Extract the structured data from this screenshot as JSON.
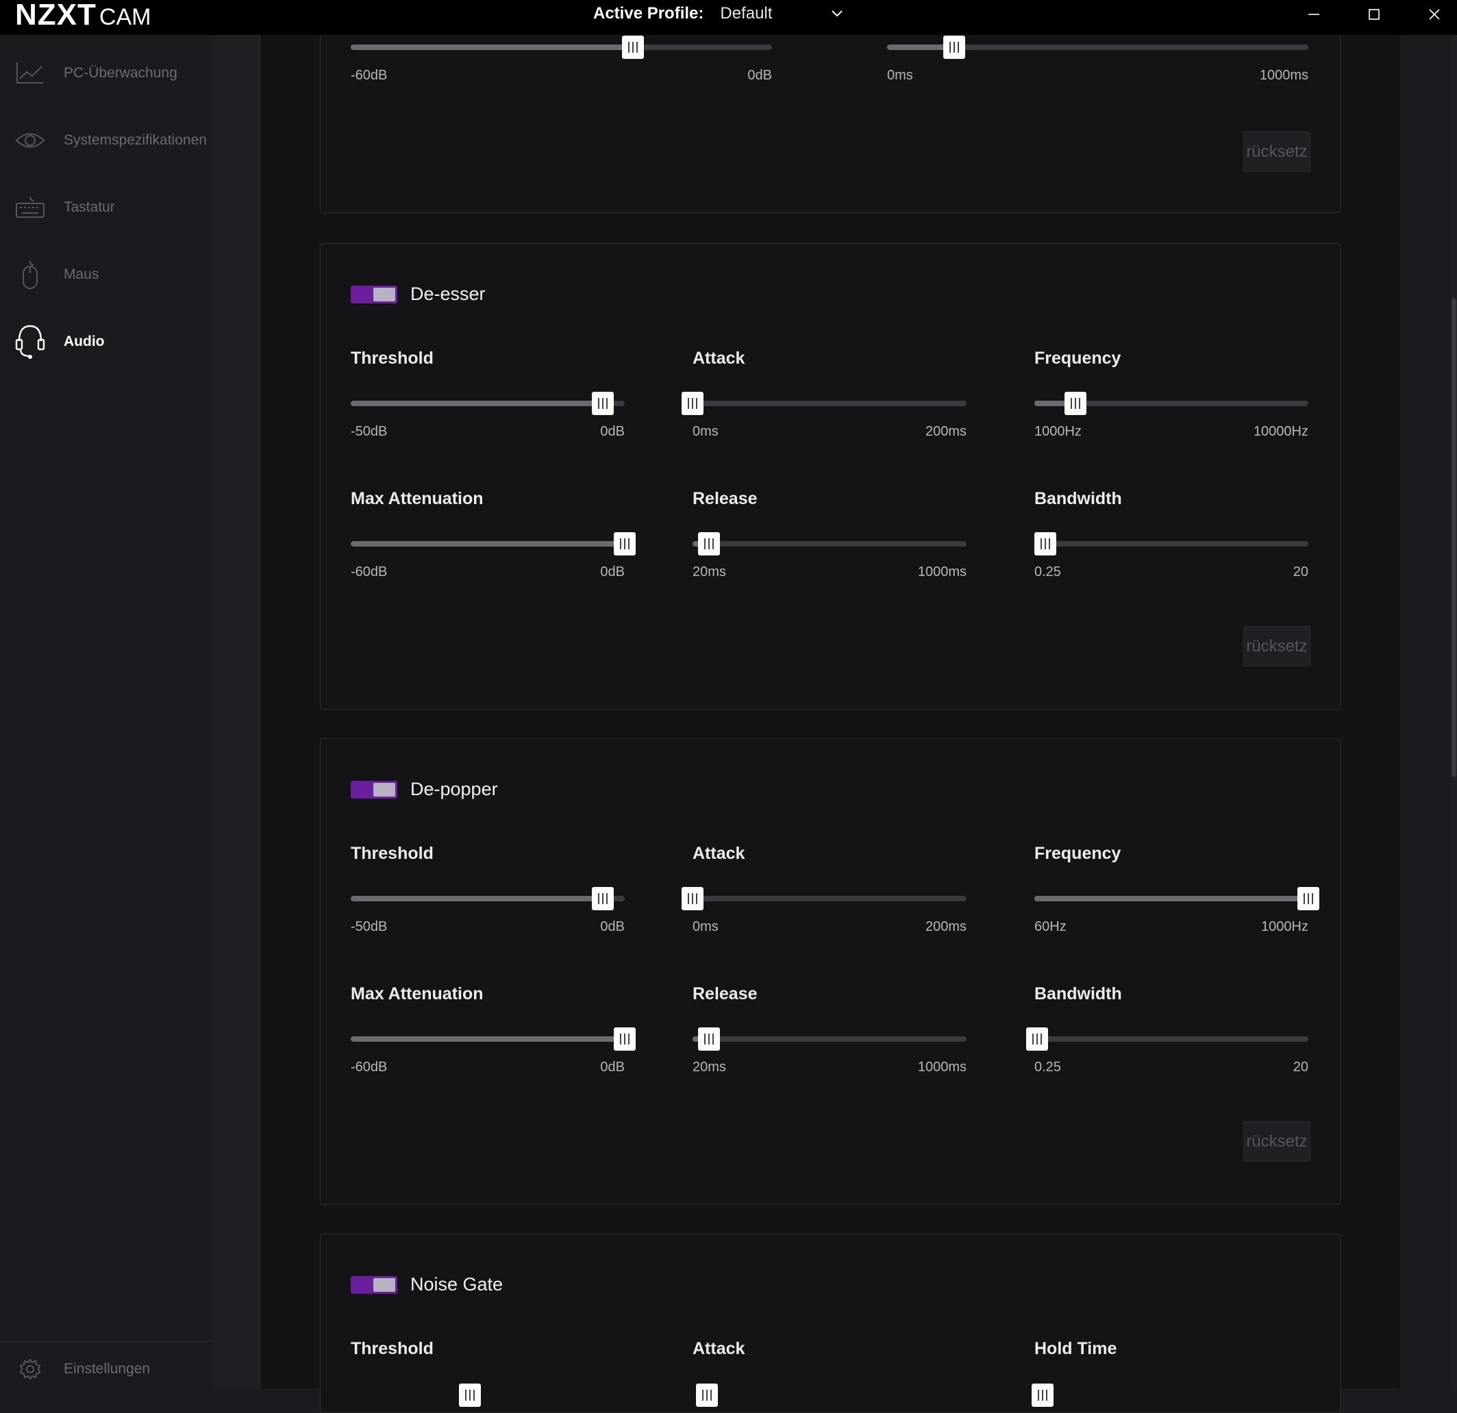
{
  "app": {
    "logo_main": "NZXT",
    "logo_sub": "CAM",
    "active_profile_label": "Active Profile:",
    "active_profile_value": "Default"
  },
  "sidebar": {
    "items": [
      {
        "label": "PC-Überwachung",
        "icon": "line-chart-icon",
        "active": false
      },
      {
        "label": "Systemspezifikationen",
        "icon": "eye-icon",
        "active": false
      },
      {
        "label": "Tastatur",
        "icon": "keyboard-icon",
        "active": false
      },
      {
        "label": "Maus",
        "icon": "mouse-icon",
        "active": false
      },
      {
        "label": "Audio",
        "icon": "headset-icon",
        "active": true
      }
    ],
    "settings_label": "Einstellungen"
  },
  "colors": {
    "accent": "#6c1f9c",
    "background": "#131316",
    "sidebar": "#1a1b1e"
  },
  "top_card": {
    "sliders": [
      {
        "min": "-60dB",
        "max": "0dB",
        "value_fraction": 0.67
      },
      {
        "min": "0ms",
        "max": "1000ms",
        "value_fraction": 0.16
      }
    ],
    "reset_label": "rücksetz"
  },
  "de_esser": {
    "title": "De-esser",
    "enabled": true,
    "params": [
      {
        "label": "Threshold",
        "min": "-50dB",
        "max": "0dB",
        "value_fraction": 0.92
      },
      {
        "label": "Attack",
        "min": "0ms",
        "max": "200ms",
        "value_fraction": 0.0
      },
      {
        "label": "Frequency",
        "min": "1000Hz",
        "max": "10000Hz",
        "value_fraction": 0.15
      },
      {
        "label": "Max Attenuation",
        "min": "-60dB",
        "max": "0dB",
        "value_fraction": 1.0
      },
      {
        "label": "Release",
        "min": "20ms",
        "max": "1000ms",
        "value_fraction": 0.06
      },
      {
        "label": "Bandwidth",
        "min": "0.25",
        "max": "20",
        "value_fraction": 0.04
      }
    ],
    "reset_label": "rücksetz"
  },
  "de_popper": {
    "title": "De-popper",
    "enabled": true,
    "params": [
      {
        "label": "Threshold",
        "min": "-50dB",
        "max": "0dB",
        "value_fraction": 0.92
      },
      {
        "label": "Attack",
        "min": "0ms",
        "max": "200ms",
        "value_fraction": 0.0
      },
      {
        "label": "Frequency",
        "min": "60Hz",
        "max": "1000Hz",
        "value_fraction": 1.0
      },
      {
        "label": "Max Attenuation",
        "min": "-60dB",
        "max": "0dB",
        "value_fraction": 1.0
      },
      {
        "label": "Release",
        "min": "20ms",
        "max": "1000ms",
        "value_fraction": 0.06
      },
      {
        "label": "Bandwidth",
        "min": "0.25",
        "max": "20",
        "value_fraction": 0.01
      }
    ],
    "reset_label": "rücksetz"
  },
  "noise_gate": {
    "title": "Noise Gate",
    "enabled": true,
    "params": [
      {
        "label": "Threshold"
      },
      {
        "label": "Attack"
      },
      {
        "label": "Hold Time"
      }
    ]
  }
}
